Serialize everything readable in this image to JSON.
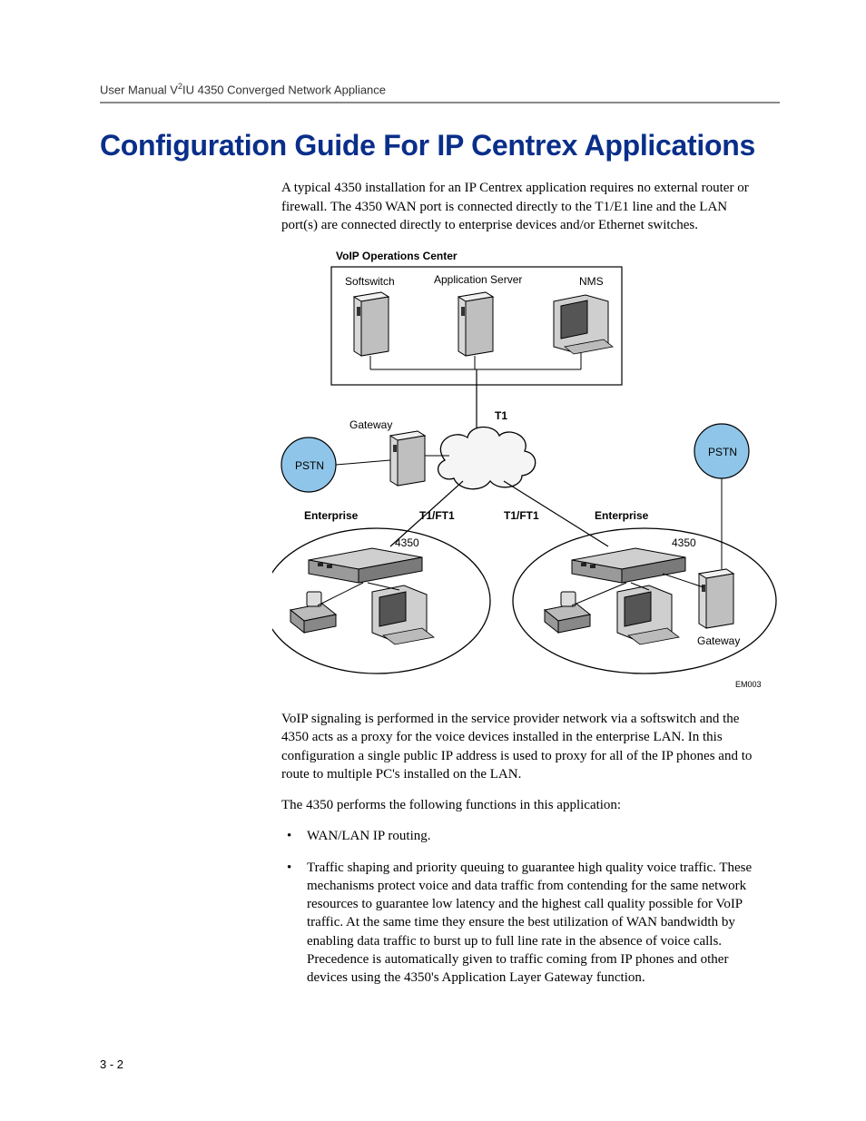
{
  "header": {
    "running_head_prefix": "User Manual V",
    "running_head_sup": "2",
    "running_head_suffix": "IU 4350 Converged Network Appliance"
  },
  "title": "Configuration Guide For IP Centrex Applications",
  "intro": "A typical 4350 installation for an IP Centrex application requires no external router or firewall. The 4350 WAN port is connected directly to the T1/E1 line and the LAN port(s) are connected directly to enterprise devices and/or Ethernet switches.",
  "diagram": {
    "top_title": "VoIP Operations Center",
    "softswitch": "Softswitch",
    "app_server": "Application Server",
    "nms": "NMS",
    "gateway": "Gateway",
    "pstn": "PSTN",
    "t1": "T1",
    "enterprise": "Enterprise",
    "t1ft1": "T1/FT1",
    "device_4350": "4350",
    "figure_id": "EM003"
  },
  "para2": "VoIP signaling is performed in the service provider network via a softswitch and the 4350 acts as a proxy for the voice devices installed in the enterprise LAN. In this configuration a single public IP address is used to proxy for all of the IP phones and to route to multiple PC's installed on the LAN.",
  "para3": "The 4350 performs the following functions in this application:",
  "bullets": [
    "WAN/LAN IP routing.",
    "Traffic shaping and priority queuing to guarantee high quality voice traffic. These mechanisms protect voice and data traffic from contending for the same network resources to guarantee low latency and the highest call quality possible for VoIP traffic. At the same time they ensure the best utilization of WAN bandwidth by enabling data traffic to burst up to full line rate in the absence of voice calls. Precedence is automatically given to traffic coming from IP phones and other devices using the 4350's Application Layer Gateway function."
  ],
  "page_number": "3 - 2"
}
